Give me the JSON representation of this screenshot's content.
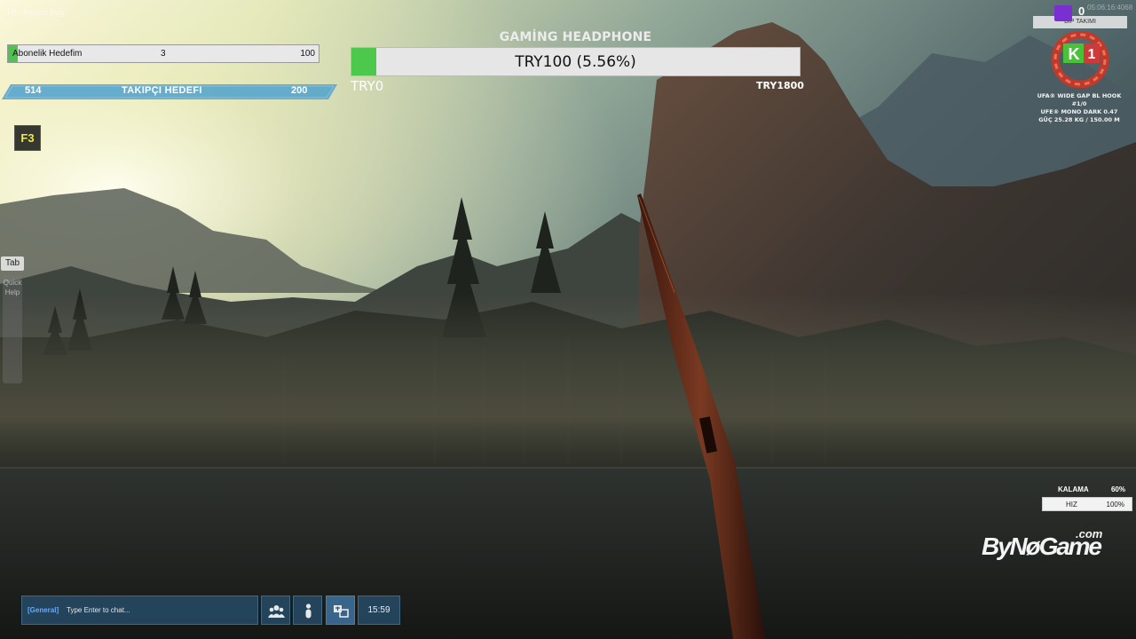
{
  "hud": {
    "report_bug": "F8 - Report Bug",
    "subscriber_goal": {
      "label": "Abonelik Hedefim",
      "current": "3",
      "target": "100",
      "progress": 0.03
    },
    "follower_goal": {
      "current": "514",
      "label": "TAKIPÇI HEDEFI",
      "target": "200"
    },
    "hotkey": "F3",
    "quick_help": {
      "tab_label": "Tab",
      "label": "Quick Help"
    },
    "donation_goal": {
      "title": "GAMİNG HEADPHONE",
      "progress_text": "TRY100 (5.56%)",
      "min": "TRY0",
      "max": "TRY1800",
      "progress": 0.0556
    },
    "top_right": {
      "timestamp": "05:06:16:4068",
      "tip_count": "0",
      "tip_label": "BIP TAKIMI",
      "rank_letter": "K",
      "rank_number": "1",
      "gear_lines": [
        "UFA® WIDE GAP BL HOOK #1/0",
        "UFE® MONO DARK 0.47",
        "GÜÇ 25.28 KG / 150.00 M"
      ]
    },
    "drag": {
      "label": "KALAMA",
      "value": "60%"
    },
    "speed": {
      "label": "HIZ",
      "value": "100%"
    },
    "watermark": {
      "main": "ByNøGame",
      "suffix": ".com"
    },
    "chat": {
      "channel": "[General]",
      "placeholder": "Type Enter to chat...",
      "time": "15:59"
    }
  },
  "icons": {
    "friends": "friends-icon",
    "player": "player-icon",
    "translate": "translate-icon"
  },
  "colors": {
    "progress_green": "#4cc84c",
    "follower_blue": "#5aa6cc",
    "hotkey_yellow": "#f2e84a",
    "chat_channel": "#66aaff"
  }
}
